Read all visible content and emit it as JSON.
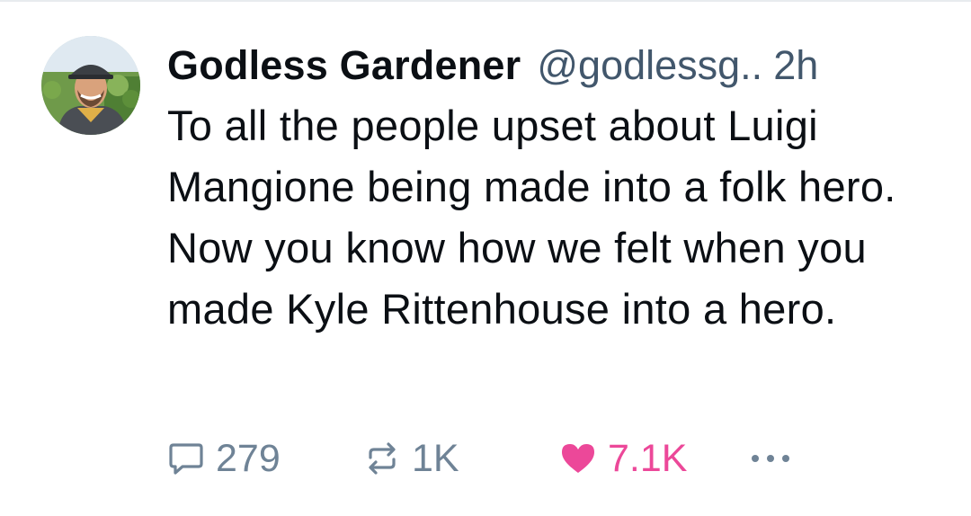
{
  "post": {
    "author": {
      "display_name": "Godless Gardener",
      "handle": "@godlessg..",
      "time": "2h"
    },
    "text": "To all the people upset about Luigi Mangione being made into a folk hero. Now you know how we felt when you made Kyle Rittenhouse into a hero.",
    "actions": {
      "reply_count": "279",
      "repost_count": "1K",
      "like_count": "7.1K",
      "liked": true,
      "more_icon": "ellipsis-icon"
    }
  },
  "colors": {
    "text": "#0b0f14",
    "muted": "#6f8396",
    "handle": "#42576c",
    "like": "#ec4899"
  }
}
